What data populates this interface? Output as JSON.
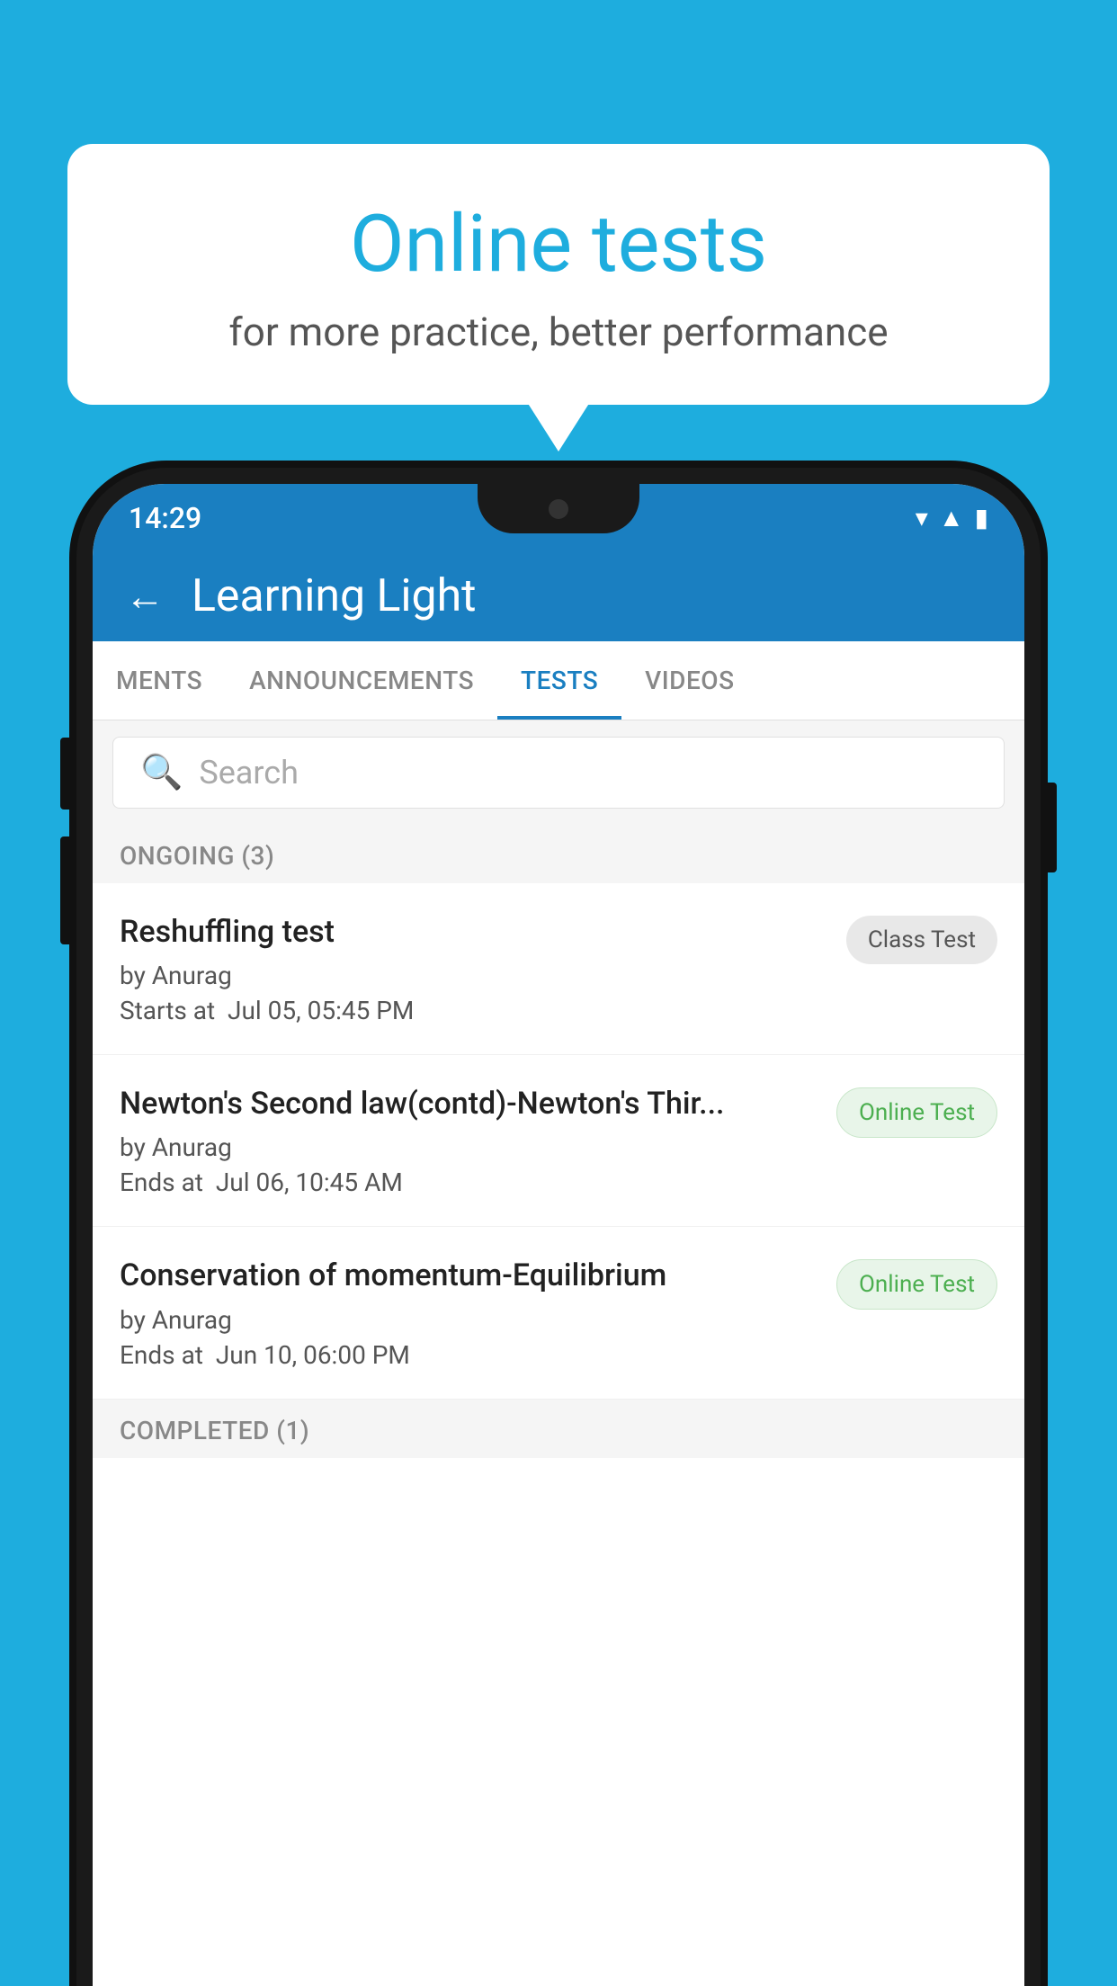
{
  "background_color": "#1EADDE",
  "bubble": {
    "title": "Online tests",
    "subtitle": "for more practice, better performance"
  },
  "phone": {
    "status_bar": {
      "time": "14:29",
      "icons": [
        "wifi",
        "signal",
        "battery"
      ]
    },
    "app_bar": {
      "back_label": "←",
      "title": "Learning Light"
    },
    "tabs": [
      {
        "label": "MENTS",
        "active": false
      },
      {
        "label": "ANNOUNCEMENTS",
        "active": false
      },
      {
        "label": "TESTS",
        "active": true
      },
      {
        "label": "VIDEOS",
        "active": false
      }
    ],
    "search": {
      "placeholder": "Search"
    },
    "sections": [
      {
        "label": "ONGOING (3)",
        "tests": [
          {
            "name": "Reshuffling test",
            "author": "by Anurag",
            "time_label": "Starts at",
            "time": "Jul 05, 05:45 PM",
            "badge": "Class Test",
            "badge_type": "class"
          },
          {
            "name": "Newton's Second law(contd)-Newton's Thir...",
            "author": "by Anurag",
            "time_label": "Ends at",
            "time": "Jul 06, 10:45 AM",
            "badge": "Online Test",
            "badge_type": "online"
          },
          {
            "name": "Conservation of momentum-Equilibrium",
            "author": "by Anurag",
            "time_label": "Ends at",
            "time": "Jun 10, 06:00 PM",
            "badge": "Online Test",
            "badge_type": "online"
          }
        ]
      }
    ],
    "completed_label": "COMPLETED (1)"
  }
}
